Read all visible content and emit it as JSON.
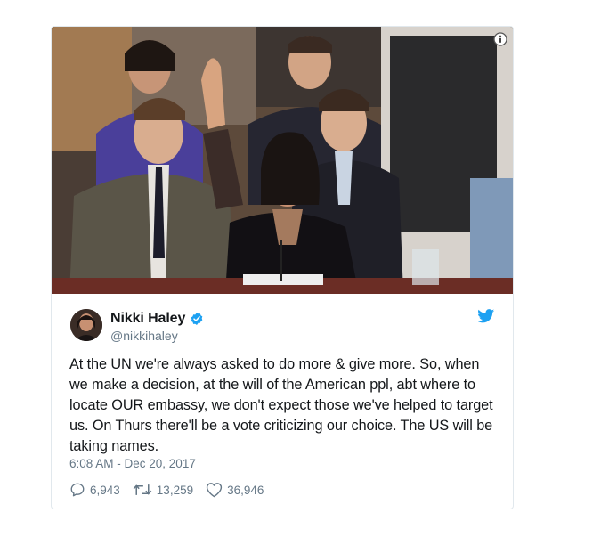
{
  "tweet": {
    "display_name": "Nikki Haley",
    "handle": "@nikkihaley",
    "text": "At the UN we're always asked to do more & give more. So, when\nwe make a decision, at the will of the American ppl, abt where to\nlocate OUR embassy, we don't expect those we've helped to target\nus. On Thurs there'll be a vote criticizing our choice. The US will be\ntaking names.",
    "timestamp": "6:08 AM - Dec 20, 2017",
    "replies": "6,943",
    "retweets": "13,259",
    "likes": "36,946"
  },
  "icons": {
    "info": "info-icon",
    "verified": "verified-badge-icon",
    "logo": "twitter-bird-icon",
    "reply": "reply-icon",
    "retweet": "retweet-icon",
    "like": "heart-icon"
  },
  "colors": {
    "accent": "#1da1f2",
    "name": "#14171a",
    "secondary": "#657786",
    "border": "#e1e8ed"
  }
}
